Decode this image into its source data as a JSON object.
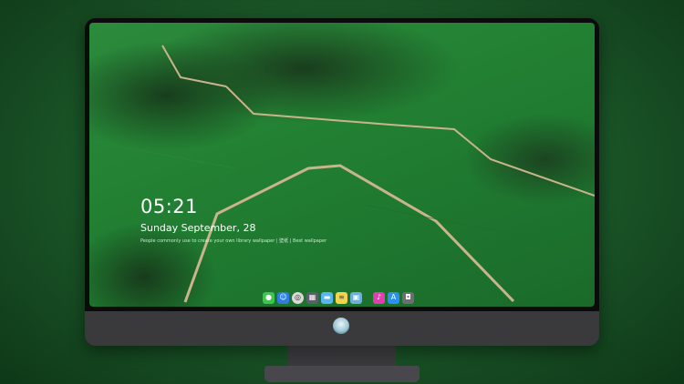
{
  "lockscreen": {
    "time": "05:21",
    "date": "Sunday September, 28",
    "quote": "People commonly use to create your own library wallpaper | 壁纸 | Best wallpaper"
  },
  "dock": {
    "icons": [
      {
        "name": "messages-icon",
        "color": "#3ec54d",
        "glyph": "●"
      },
      {
        "name": "finder-icon",
        "color": "#2f7de1",
        "glyph": "☺"
      },
      {
        "name": "safari-icon",
        "color": "#d9d9d9",
        "glyph": "◎"
      },
      {
        "name": "preview-icon",
        "color": "#5a5f69",
        "glyph": "▦"
      },
      {
        "name": "files-icon",
        "color": "#58b5f0",
        "glyph": "▬"
      },
      {
        "name": "notes-icon",
        "color": "#f4d34a",
        "glyph": "≡"
      },
      {
        "name": "photos-icon",
        "color": "#6ab0d8",
        "glyph": "▣"
      },
      {
        "name": "music-icon",
        "color": "#e13fb0",
        "glyph": "♪"
      },
      {
        "name": "app-store-icon",
        "color": "#2d8ef3",
        "glyph": "A"
      },
      {
        "name": "camera-icon",
        "color": "#6d6e73",
        "glyph": "◘"
      }
    ]
  }
}
